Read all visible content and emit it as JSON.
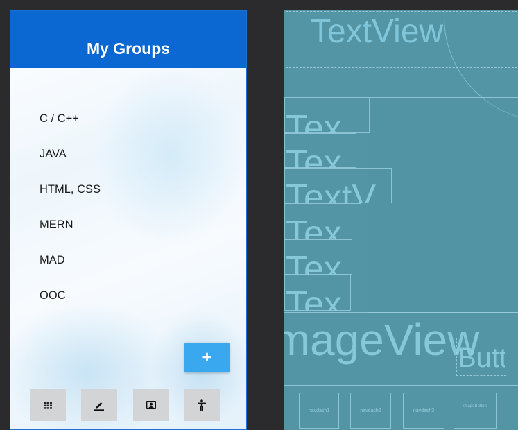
{
  "phone": {
    "title": "My Groups",
    "groups": [
      "C / C++",
      "JAVA",
      "HTML, CSS",
      "MERN",
      "MAD",
      "OOC"
    ],
    "fab_label": "+",
    "nav": [
      {
        "icon": "grid-icon"
      },
      {
        "icon": "edit-icon"
      },
      {
        "icon": "contact-card-icon"
      },
      {
        "icon": "accessibility-icon"
      }
    ],
    "colors": {
      "appbar": "#0b67d1",
      "fab": "#3aa8ef",
      "nav_button": "#d3d4d5"
    }
  },
  "blueprint": {
    "header_text": "TextView",
    "list_text_1": "Tex",
    "list_text_2": "Tex",
    "list_text_3": "TextV",
    "list_text_4": "Tex",
    "list_text_5": "Tex",
    "list_text_6": "Tex",
    "image_text": "ImageView",
    "button_text": "Butto",
    "nav_labels": [
      "navdash1",
      "navdash2",
      "navdash3",
      "imageButton"
    ],
    "colors": {
      "background": "#5395a5",
      "outline": "#96cddc"
    }
  }
}
